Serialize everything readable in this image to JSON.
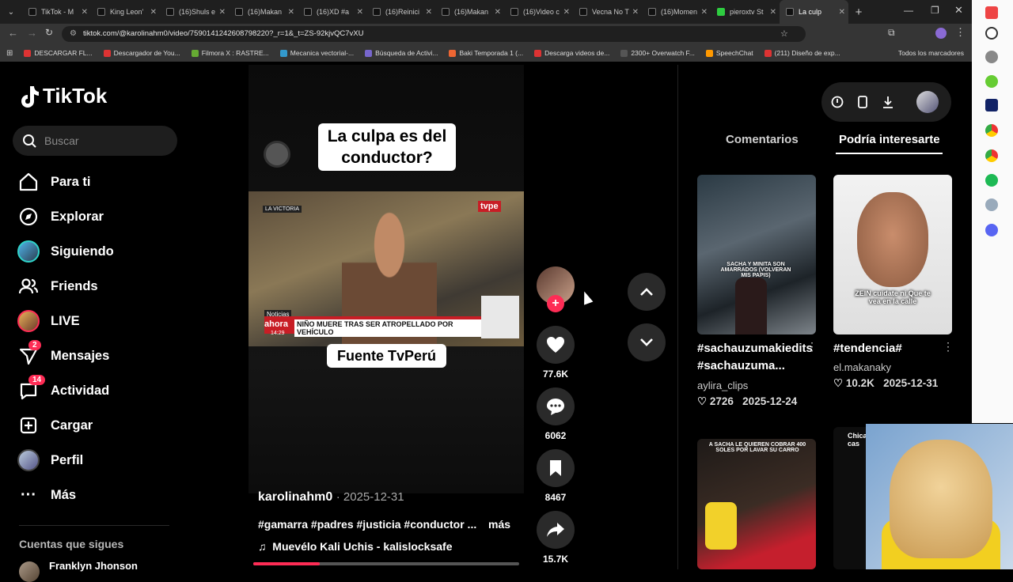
{
  "browser": {
    "tabs": [
      {
        "label": "TikTok - M",
        "active": false
      },
      {
        "label": "King Leon'",
        "active": false
      },
      {
        "label": "(16)Shuls e",
        "active": false
      },
      {
        "label": "(16)Makan",
        "active": false
      },
      {
        "label": "(16)XD #a",
        "active": false
      },
      {
        "label": "(16)Reinici",
        "active": false
      },
      {
        "label": "(16)Makan",
        "active": false
      },
      {
        "label": "(16)Video c",
        "active": false
      },
      {
        "label": "Vecna No T",
        "active": false
      },
      {
        "label": "(16)Momen",
        "active": false
      },
      {
        "label": "pieroxtv St",
        "active": false
      },
      {
        "label": "La culp",
        "active": true
      }
    ],
    "url": "tiktok.com/@karolinahm0/video/7590141242608798220?_r=1&_t=ZS-92kjvQC7vXU",
    "bookmarks": [
      "DESCARGAR FL...",
      "Descargador de You...",
      "Filmora X : RASTRE...",
      "Mecanica vectorial-...",
      "Búsqueda de Activi...",
      "Baki Temporada 1 (...",
      "Descarga videos de...",
      "2300+ Overwatch F...",
      "SpeechChat",
      "(211) Diseño de exp..."
    ],
    "all_bookmarks": "Todos los marcadores"
  },
  "sidebar": {
    "logo": "TikTok",
    "search_placeholder": "Buscar",
    "items": [
      {
        "label": "Para ti",
        "icon": "home-icon"
      },
      {
        "label": "Explorar",
        "icon": "compass-icon"
      },
      {
        "label": "Siguiendo",
        "icon": "following-avatar"
      },
      {
        "label": "Friends",
        "icon": "friends-icon"
      },
      {
        "label": "LIVE",
        "icon": "live-avatar"
      },
      {
        "label": "Mensajes",
        "icon": "messages-icon",
        "badge": "2"
      },
      {
        "label": "Actividad",
        "icon": "activity-icon",
        "badge": "14"
      },
      {
        "label": "Cargar",
        "icon": "upload-icon"
      },
      {
        "label": "Perfil",
        "icon": "profile-avatar"
      },
      {
        "label": "Más",
        "icon": "more-icon"
      }
    ],
    "following_title": "Cuentas que sigues",
    "following_first": "Franklyn Jhonson"
  },
  "video": {
    "caption_top": "La culpa es del conductor?",
    "caption_bottom": "Fuente TvPerú",
    "news_ticker": "NIÑO MUERE TRAS SER ATROPELLADO POR VEHÍCULO",
    "news_noticias": "Noticias",
    "news_ahora": "ahora",
    "news_time": "14:29",
    "news_location": "LA VICTORIA",
    "author": "karolinahm0",
    "date": "· 2025-12-31",
    "tags": "#gamarra #padres #justicia #conductor ...",
    "more": "más",
    "music": "Muevélo Kali Uchis - kalislocksafe",
    "progress": 0.25
  },
  "actions": {
    "likes": "77.6K",
    "comments": "6062",
    "saves": "8467",
    "shares": "15.7K"
  },
  "right_panel": {
    "tabs": [
      "Comentarios",
      "Podría interesarte"
    ],
    "active_tab": 1,
    "videos": [
      {
        "title": "#sachauzumakiedits #sachauzuma...",
        "user": "aylira_clips",
        "likes": "2726",
        "date": "2025-12-24",
        "overlay": "SACHA Y MINITA SON AMARRADOS (VOLVERAN MIS PAPIS)"
      },
      {
        "title": "#tendencia#",
        "user": "el.makanaky",
        "likes": "10.2K",
        "date": "2025-12-31",
        "overlay": "ZEIN cuidate ni Que te vea en la calle"
      },
      {
        "overlay": "A SACHA LE QUIEREN COBRAR 400 SOLES POR LAVAR SU CARRO"
      },
      {
        "overlay": "Chica cas"
      }
    ]
  },
  "colors": {
    "accent": "#fe2c55",
    "background": "#000000"
  }
}
